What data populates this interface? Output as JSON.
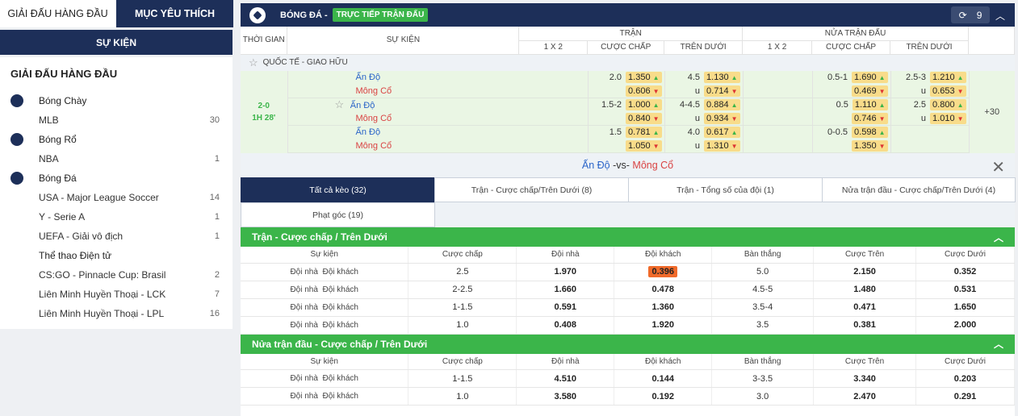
{
  "left": {
    "tab_top": "GIẢI ĐẤU HÀNG ĐẦU",
    "tab_fav": "MỤC YÊU THÍCH",
    "events": "SỰ KIỆN",
    "heading": "GIẢI ĐẤU HÀNG ĐẦU",
    "groups": [
      {
        "sport": "Bóng Chày",
        "icon": "baseball-icon",
        "leagues": [
          {
            "name": "MLB",
            "count": "30"
          }
        ]
      },
      {
        "sport": "Bóng Rổ",
        "icon": "basketball-icon",
        "leagues": [
          {
            "name": "NBA",
            "count": "1"
          }
        ]
      },
      {
        "sport": "Bóng Đá",
        "icon": "soccer-icon",
        "leagues": [
          {
            "name": "USA - Major League Soccer",
            "count": "14"
          },
          {
            "name": "Y - Serie A",
            "count": "1"
          },
          {
            "name": "UEFA - Giải vô địch",
            "count": "1"
          }
        ]
      },
      {
        "sport": "Thể thao Điện tử",
        "icon": "headset-icon",
        "leagues": [
          {
            "name": "CS:GO - Pinnacle Cup: Brasil",
            "count": "2"
          },
          {
            "name": "Liên Minh Huyền Thoại - LCK",
            "count": "7"
          },
          {
            "name": "Liên Minh Huyền Thoại - LPL",
            "count": "16"
          }
        ]
      }
    ]
  },
  "header": {
    "title": "BÓNG ĐÁ -",
    "live": "TRỰC TIẾP TRẬN ĐẤU",
    "count": "9"
  },
  "grid": {
    "time": "THỜI GIAN",
    "event": "SỰ KIỆN",
    "match": "TRẬN",
    "half": "NỬA TRẬN ĐẤU",
    "c1x2": "1 X 2",
    "hc": "CƯỢC CHẤP",
    "ou": "TRÊN DƯỚI",
    "league": "QUỐC TẾ - GIAO HỮU"
  },
  "match": {
    "score": "2-0",
    "time": "1H 28'",
    "home": "Ấn Độ",
    "away": "Mông Cổ",
    "more": "+30",
    "rows": [
      {
        "hc": "2.0",
        "hc1": "1.350",
        "hc2": "0.606",
        "ou": "4.5",
        "ou1": "1.130",
        "ou2": "0.714",
        "hhc": "0.5-1",
        "hhc1": "1.690",
        "hhc2": "0.469",
        "hou": "2.5-3",
        "hou1": "1.210",
        "hou2": "0.653",
        "u": "u"
      },
      {
        "hc": "1.5-2",
        "hc1": "1.000",
        "hc2": "0.840",
        "ou": "4-4.5",
        "ou1": "0.884",
        "ou2": "0.934",
        "hhc": "0.5",
        "hhc1": "1.110",
        "hhc2": "0.746",
        "hou": "2.5",
        "hou1": "0.800",
        "hou2": "1.010",
        "u": "u"
      },
      {
        "hc": "1.5",
        "hc1": "0.781",
        "hc2": "1.050",
        "ou": "4.0",
        "ou1": "0.617",
        "ou2": "1.310",
        "hhc": "0-0.5",
        "hhc1": "0.598",
        "hhc2": "1.350",
        "hou": "",
        "hou1": "",
        "hou2": "",
        "u": "u"
      }
    ]
  },
  "detail": {
    "home": "Ấn Độ",
    "vs": "-vs-",
    "away": "Mông Cổ",
    "tabs": [
      "Tất cả kèo (32)",
      "Trận - Cược chấp/Trên Dưới (8)",
      "Trận - Tổng số của đội (1)",
      "Nửa trận đầu - Cược chấp/Trên Dưới (4)",
      "Phạt góc (19)"
    ],
    "cols": [
      "Sự kiện",
      "Cược chấp",
      "Đội nhà",
      "Đội khách",
      "Bàn thắng",
      "Cược Trên",
      "Cược Dưới"
    ],
    "team_label": "Đội nhà  Đội khách",
    "sec1": "Trận - Cược chấp / Trên Dưới",
    "rows1": [
      [
        "2.5",
        "1.970",
        "0.396",
        "5.0",
        "2.150",
        "0.352"
      ],
      [
        "2-2.5",
        "1.660",
        "0.478",
        "4.5-5",
        "1.480",
        "0.531"
      ],
      [
        "1-1.5",
        "0.591",
        "1.360",
        "3.5-4",
        "0.471",
        "1.650"
      ],
      [
        "1.0",
        "0.408",
        "1.920",
        "3.5",
        "0.381",
        "2.000"
      ]
    ],
    "sec2": "Nửa trận đầu - Cược chấp / Trên Dưới",
    "rows2": [
      [
        "1-1.5",
        "4.510",
        "0.144",
        "3-3.5",
        "3.340",
        "0.203"
      ],
      [
        "1.0",
        "3.580",
        "0.192",
        "3.0",
        "2.470",
        "0.291"
      ]
    ]
  }
}
